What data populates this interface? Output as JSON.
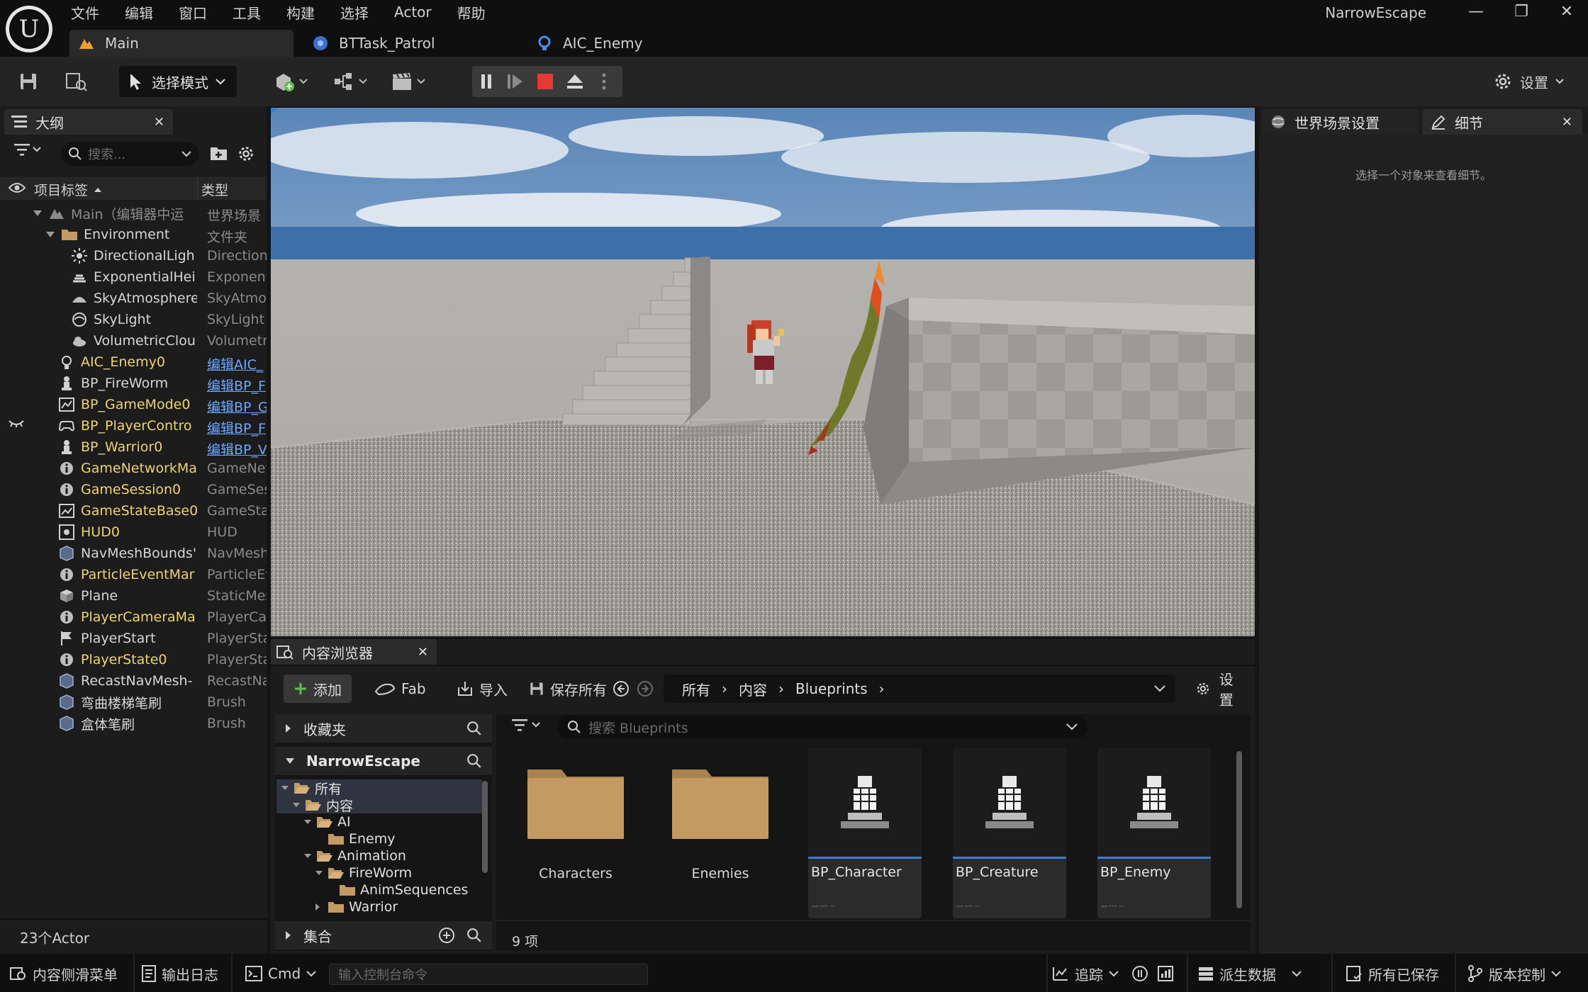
{
  "app": {
    "window_title": "NarrowEscape",
    "logo_glyph": "U",
    "menu": [
      "文件",
      "编辑",
      "窗口",
      "工具",
      "构建",
      "选择",
      "Actor",
      "帮助"
    ],
    "tabs": [
      {
        "label": "Main",
        "active": true
      },
      {
        "label": "BTTask_Patrol",
        "active": false
      },
      {
        "label": "AIC_Enemy",
        "active": false
      }
    ],
    "window_controls": {
      "minimize": "—",
      "maximize": "❐",
      "close": "✕"
    }
  },
  "toolbar": {
    "mode_label": "选择模式",
    "settings_label": "设置"
  },
  "outliner": {
    "tab_label": "大纲",
    "search_placeholder": "搜索...",
    "col_label": "项目标签",
    "col_type": "类型",
    "rows": [
      {
        "label": "Main（编辑器中运",
        "type": "世界场景",
        "indent": 1,
        "kind": "world",
        "expander": "open"
      },
      {
        "label": "Environment",
        "type": "文件夹",
        "indent": 2,
        "kind": "folder",
        "expander": "open"
      },
      {
        "label": "DirectionalLigh",
        "type": "Direction",
        "indent": 3,
        "kind": "sun"
      },
      {
        "label": "ExponentialHei",
        "type": "Exponent",
        "indent": 3,
        "kind": "fog"
      },
      {
        "label": "SkyAtmosphere",
        "type": "SkyAtmos",
        "indent": 3,
        "kind": "sky"
      },
      {
        "label": "SkyLight",
        "type": "SkyLight",
        "indent": 3,
        "kind": "skylight"
      },
      {
        "label": "VolumetricClou",
        "type": "Volumetr",
        "indent": 3,
        "kind": "cloud"
      },
      {
        "label": "AIC_Enemy0",
        "type": "编辑AIC_",
        "indent": 2,
        "kind": "ai",
        "yellow": true,
        "link": true
      },
      {
        "label": "BP_FireWorm",
        "type": "编辑BP_F",
        "indent": 2,
        "kind": "pawn",
        "link": true
      },
      {
        "label": "BP_GameMode0",
        "type": "编辑BP_G",
        "indent": 2,
        "kind": "gamemode",
        "yellow": true,
        "link": true
      },
      {
        "label": "BP_PlayerContro",
        "type": "编辑BP_F",
        "indent": 2,
        "kind": "controller",
        "yellow": true,
        "link": true,
        "hidden_eye": true
      },
      {
        "label": "BP_Warrior0",
        "type": "编辑BP_V",
        "indent": 2,
        "kind": "pawn",
        "yellow": true,
        "link": true
      },
      {
        "label": "GameNetworkMa",
        "type": "GameNet",
        "indent": 2,
        "kind": "info",
        "yellow": true
      },
      {
        "label": "GameSession0",
        "type": "GameSes",
        "indent": 2,
        "kind": "info",
        "yellow": true
      },
      {
        "label": "GameStateBase0",
        "type": "GameSta",
        "indent": 2,
        "kind": "gamestate",
        "yellow": true
      },
      {
        "label": "HUD0",
        "type": "HUD",
        "indent": 2,
        "kind": "hud",
        "yellow": true
      },
      {
        "label": "NavMeshBounds'",
        "type": "NavMesh",
        "indent": 2,
        "kind": "volume"
      },
      {
        "label": "ParticleEventMar",
        "type": "ParticleEv",
        "indent": 2,
        "kind": "info",
        "yellow": true
      },
      {
        "label": "Plane",
        "type": "StaticMes",
        "indent": 2,
        "kind": "mesh"
      },
      {
        "label": "PlayerCameraMa",
        "type": "PlayerCar",
        "indent": 2,
        "kind": "info",
        "yellow": true
      },
      {
        "label": "PlayerStart",
        "type": "PlayerSta",
        "indent": 2,
        "kind": "flag"
      },
      {
        "label": "PlayerState0",
        "type": "PlayerSta",
        "indent": 2,
        "kind": "info",
        "yellow": true
      },
      {
        "label": "RecastNavMesh-",
        "type": "RecastNa",
        "indent": 2,
        "kind": "volume"
      },
      {
        "label": "弯曲楼梯笔刷",
        "type": "Brush",
        "indent": 2,
        "kind": "volume"
      },
      {
        "label": "盒体笔刷",
        "type": "Brush",
        "indent": 2,
        "kind": "volume"
      }
    ],
    "actor_count": "23个Actor"
  },
  "details": {
    "tab_world": "世界场景设置",
    "tab_details": "细节",
    "empty_message": "选择一个对象来查看细节。"
  },
  "content_browser": {
    "tab_label": "内容浏览器",
    "add_label": "添加",
    "fab_label": "Fab",
    "import_label": "导入",
    "save_all_label": "保存所有",
    "breadcrumb": [
      "所有",
      "内容",
      "Blueprints"
    ],
    "settings_label": "设置",
    "favorites_label": "收藏夹",
    "project_label": "NarrowEscape",
    "collections_label": "集合",
    "search_placeholder": "搜索 Blueprints",
    "tree": [
      {
        "label": "所有",
        "indent": 0,
        "expander": "open",
        "selected": true
      },
      {
        "label": "内容",
        "indent": 1,
        "expander": "open",
        "selected": true
      },
      {
        "label": "AI",
        "indent": 2,
        "expander": "open"
      },
      {
        "label": "Enemy",
        "indent": 3,
        "expander": ""
      },
      {
        "label": "Animation",
        "indent": 2,
        "expander": "open"
      },
      {
        "label": "FireWorm",
        "indent": 3,
        "expander": "open"
      },
      {
        "label": "AnimSequences",
        "indent": 4,
        "expander": ""
      },
      {
        "label": "Warrior",
        "indent": 3,
        "expander": "closed"
      }
    ],
    "assets": [
      {
        "label": "Characters",
        "kind": "folder"
      },
      {
        "label": "Enemies",
        "kind": "folder"
      },
      {
        "label": "BP_Character",
        "kind": "blueprint",
        "sub": "蓝图类"
      },
      {
        "label": "BP_Creature",
        "kind": "blueprint",
        "sub": "蓝图类"
      },
      {
        "label": "BP_Enemy",
        "kind": "blueprint",
        "sub": "蓝图类"
      }
    ],
    "item_count": "9 项"
  },
  "statusbar": {
    "content_drawer": "内容侧滑菜单",
    "output_log": "输出日志",
    "cmd_label": "Cmd",
    "console_placeholder": "输入控制台命令",
    "trace_label": "追踪",
    "derived_data": "派生数据",
    "all_saved": "所有已保存",
    "source_control": "版本控制"
  },
  "colors": {
    "accent_yellow": "#f0d36a",
    "link_blue": "#6da8ff",
    "stop_red": "#e53935",
    "folder_tan": "#c39b62",
    "add_green": "#5fbf4a"
  }
}
